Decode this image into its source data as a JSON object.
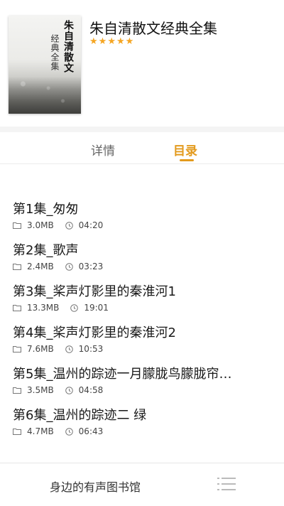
{
  "book": {
    "cover_title": "朱自清散文",
    "cover_subtitle": "经典全集",
    "title": "朱自清散文经典全集",
    "rating_stars": 5,
    "star_icon": "star-icon",
    "accent_color": "#e39a1d"
  },
  "tabs": [
    {
      "label": "详情",
      "active": false
    },
    {
      "label": "目录",
      "active": true
    }
  ],
  "episodes": [
    {
      "title": "第1集_匆匆",
      "size": "3.0MB",
      "duration": "04:20"
    },
    {
      "title": "第2集_歌声",
      "size": "2.4MB",
      "duration": "03:23"
    },
    {
      "title": "第3集_桨声灯影里的秦淮河1",
      "size": "13.3MB",
      "duration": "19:01"
    },
    {
      "title": "第4集_桨声灯影里的秦淮河2",
      "size": "7.6MB",
      "duration": "10:53"
    },
    {
      "title": "第5集_温州的踪迹一月朦胧鸟朦胧帘…",
      "size": "3.5MB",
      "duration": "04:58"
    },
    {
      "title": "第6集_温州的踪迹二 绿",
      "size": "4.7MB",
      "duration": "06:43"
    }
  ],
  "bottom_bar": {
    "label": "身边的有声图书馆",
    "menu_icon": "list-menu-icon"
  }
}
